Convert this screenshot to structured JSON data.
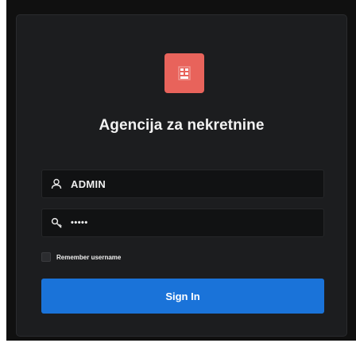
{
  "app": {
    "title": "Agencija za nekretnine",
    "logo_icon": "building-grid-icon",
    "accent_color": "#e8635b"
  },
  "login": {
    "username": {
      "icon": "user-icon",
      "value": "ADMIN"
    },
    "password": {
      "icon": "key-icon",
      "value": "•••••"
    },
    "remember": {
      "label": "Remember username",
      "checked": false
    },
    "submit": {
      "label": "Sign In",
      "color": "#1a73d9"
    }
  }
}
